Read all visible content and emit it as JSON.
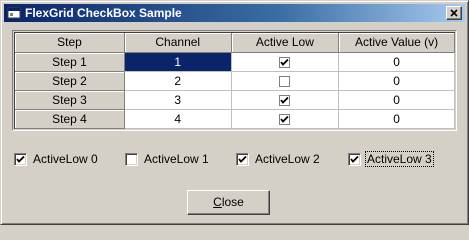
{
  "window": {
    "title": "FlexGrid CheckBox Sample",
    "close_glyph": "×",
    "app_icon": "window-app-icon"
  },
  "grid": {
    "columns": [
      "Step",
      "Channel",
      "Active Low",
      "Active Value (v)"
    ],
    "rows": [
      {
        "step": "Step 1",
        "channel": "1",
        "active_low": true,
        "active_value": "0"
      },
      {
        "step": "Step 2",
        "channel": "2",
        "active_low": false,
        "active_value": "0"
      },
      {
        "step": "Step 3",
        "channel": "3",
        "active_low": true,
        "active_value": "0"
      },
      {
        "step": "Step 4",
        "channel": "4",
        "active_low": true,
        "active_value": "0"
      }
    ],
    "selected_row": 0
  },
  "checkboxes": [
    {
      "label": "ActiveLow 0",
      "checked": true
    },
    {
      "label": "ActiveLow 1",
      "checked": false
    },
    {
      "label": "ActiveLow 2",
      "checked": true
    },
    {
      "label": "ActiveLow 3",
      "checked": true
    }
  ],
  "close_button": {
    "label_mnemonic": "C",
    "label_rest": "lose"
  },
  "colors": {
    "face": "#d4d0c8",
    "title_start": "#0a246a",
    "title_end": "#a6caf0",
    "selection": "#0a246a"
  }
}
